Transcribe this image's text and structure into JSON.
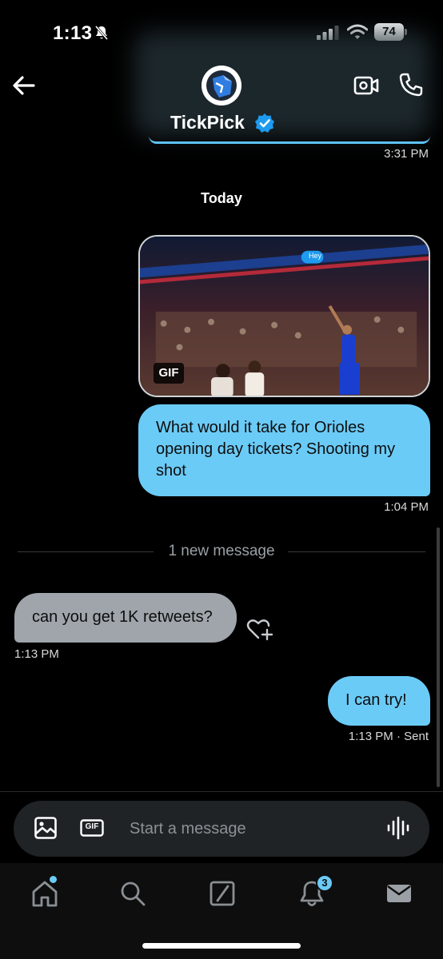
{
  "status_bar": {
    "time": "1:13",
    "battery": "74",
    "icons": [
      "bell-slash-icon",
      "cellular-signal-icon",
      "wifi-icon",
      "battery-icon"
    ]
  },
  "header": {
    "contact_name": "TickPick",
    "verified": true,
    "icons": [
      "back-arrow-icon",
      "video-call-icon",
      "phone-icon",
      "verified-badge-icon"
    ]
  },
  "conversation": {
    "previous_time": "3:31 PM",
    "day_separator": "Today",
    "gif": {
      "badge": "GIF",
      "caption_bubble": "Hey"
    },
    "messages": [
      {
        "direction": "out",
        "text": "What would it take for Orioles opening day tickets? Shooting my shot",
        "time": "1:04 PM"
      },
      {
        "direction": "in",
        "text": "can you get 1K retweets?",
        "time": "1:13 PM"
      },
      {
        "direction": "out",
        "text": "I can try!",
        "time": "1:13 PM",
        "status": "· Sent"
      }
    ],
    "new_message_divider": "1 new message"
  },
  "composer": {
    "placeholder": "Start a message",
    "gif_button_label": "GIF",
    "icons": [
      "image-icon",
      "gif-icon",
      "voice-waveform-icon"
    ]
  },
  "tab_bar": {
    "notification_count": "3",
    "tabs": [
      "home-icon",
      "search-icon",
      "grok-icon",
      "notifications-icon",
      "messages-icon"
    ]
  },
  "colors": {
    "outgoing_bubble": "#6bcbf7",
    "incoming_bubble": "#9fa5ab",
    "accent": "#1d9bf0",
    "background": "#000000"
  }
}
